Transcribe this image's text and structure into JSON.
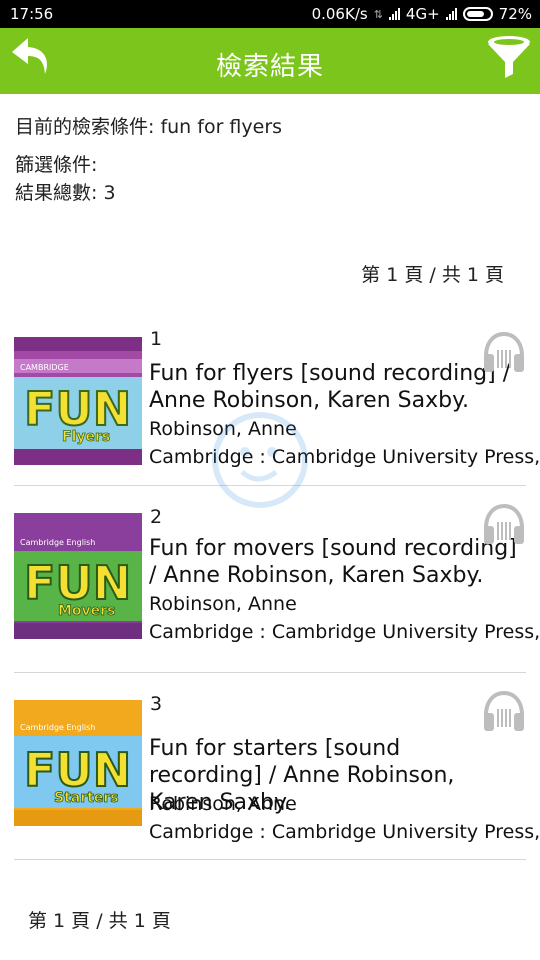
{
  "status_bar": {
    "time": "17:56",
    "network_speed": "0.06K/s",
    "network_type": "4G+",
    "battery": "72%"
  },
  "header": {
    "title": "檢索結果",
    "back_icon": "back-arrow-icon",
    "filter_icon": "filter-funnel-icon",
    "accent_color": "#7cc51c"
  },
  "search_info": {
    "query_line": "目前的檢索條件: fun for flyers",
    "filter_line": "篩選條件:",
    "total_line": "結果總數: 3"
  },
  "pagination": {
    "top": "第 1 頁 / 共 1 頁",
    "bottom": "第 1 頁 / 共 1 頁"
  },
  "results": [
    {
      "index": "1",
      "title": "Fun for flyers [sound recording] / Anne Robinson, Karen Saxby.",
      "author": "Robinson, Anne",
      "publisher": "Cambridge : Cambridge University Press,",
      "cover_brand": "CAMBRIDGE",
      "cover_word": "FUN",
      "cover_sub": "Flyers",
      "cover_bg": "#a24aa6"
    },
    {
      "index": "2",
      "title": "Fun for movers [sound recording] / Anne Robinson, Karen Saxby.",
      "author": "Robinson, Anne",
      "publisher": "Cambridge : Cambridge University Press,",
      "cover_brand": "Cambridge English",
      "cover_word": "FUN",
      "cover_sub": "Movers",
      "cover_bg": "#8b3f9d"
    },
    {
      "index": "3",
      "title": "Fun for starters [sound recording] / Anne Robinson, Karen Saxby.",
      "author": "Robinson, Anne",
      "publisher": "Cambridge : Cambridge University Press,",
      "cover_brand": "Cambridge English",
      "cover_word": "FUN",
      "cover_sub": "Starters",
      "cover_bg": "#f2a91e"
    }
  ]
}
